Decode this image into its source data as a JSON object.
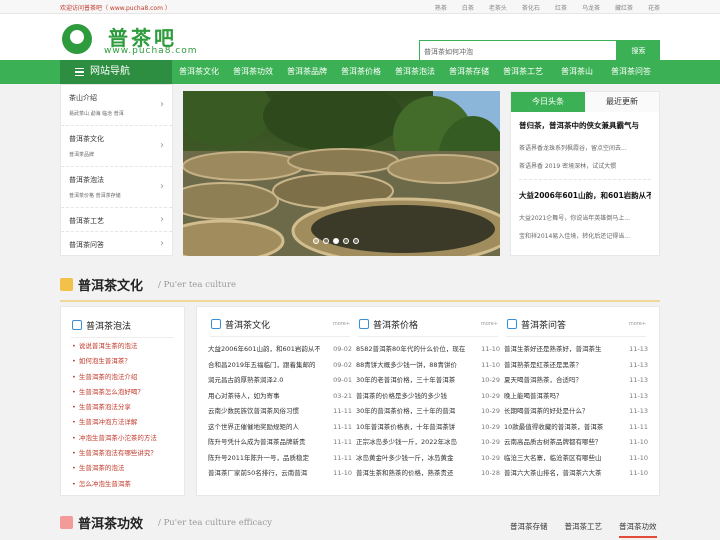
{
  "topbar": {
    "welcome": "欢迎访问普茶吧（ www.pucha8.com ）",
    "links": [
      "熟茶",
      "白茶",
      "老茶头",
      "茶化石",
      "红茶",
      "乌龙茶",
      "藏红茶",
      "花茶"
    ]
  },
  "logo": {
    "name": "普茶吧",
    "url": "www.pucha8.com"
  },
  "search": {
    "placeholder": "普洱茶如何冲泡",
    "button": "搜索"
  },
  "nav": {
    "title": "网站导航",
    "items": [
      "普洱茶文化",
      "普洱茶功效",
      "普洱茶品牌",
      "普洱茶价格",
      "普洱茶泡法",
      "普洱茶存储",
      "普洱茶工艺",
      "普洱茶山",
      "普洱茶问答"
    ]
  },
  "sidenav": [
    {
      "title": "茶山介绍",
      "sub": "易武茶山  勐海  临沧  普洱"
    },
    {
      "title": "普洱茶文化",
      "sub": "普洱茶品牌"
    },
    {
      "title": "普洱茶泡法",
      "sub": "普洱茶价格  普洱茶存储"
    },
    {
      "title": "普洱茶工艺",
      "sub": ""
    },
    {
      "title": "普洱茶问答",
      "sub": ""
    }
  ],
  "colors": {
    "brand_green": "#3cb054",
    "nav_dark_green": "#2d8d41",
    "accent_red": "#c0392b"
  },
  "news": {
    "tabs": [
      "今日头条",
      "最近更新"
    ],
    "blocks": [
      {
        "headline": "普归茶，普洱茶中的侠女兼具霸气与",
        "lines": [
          "茶语界香龙珠系列枫霞谷，留点空间去...",
          "茶语界香 2019 密境深林，试试大惯"
        ]
      },
      {
        "headline": "大益2006年601山韵，和601岩韵从不",
        "lines": [
          "大益2021仑舞号，你说当年英雄倒马上...",
          "宝和祥2014易入佳境，转化后还记得当..."
        ]
      }
    ]
  },
  "section1": {
    "title": "普洱茶文化",
    "subtitle": "/ Pu'er tea culture"
  },
  "brew": {
    "title": "普洱茶泡法",
    "items": [
      "说说普洱生茶的泡法",
      "如何泡生普洱茶？",
      "生普洱茶的泡法介绍",
      "生普洱茶怎么泡好喝？",
      "生普洱茶泡法分享",
      "生普洱冲泡方法详解",
      "冲泡生普洱茶小沱茶的方法",
      "生普洱茶泡法有哪些讲究？",
      "生普洱茶的泡法",
      "怎么冲泡生普洱茶"
    ]
  },
  "lists": [
    {
      "title": "普洱茶文化",
      "more": "more+",
      "rows": [
        {
          "t": "大益2006年601山韵，和601岩韵从不",
          "d": "09-02"
        },
        {
          "t": "合和昌2019年五福临门，跟着集邮的",
          "d": "09-02"
        },
        {
          "t": "润元昌古韵厚熟茶润泽2.0",
          "d": "09-01"
        },
        {
          "t": "用心对茶待人，如为寄事",
          "d": "03-21"
        },
        {
          "t": "云南少数民族饮普洱茶风俗习惯",
          "d": "11-11"
        },
        {
          "t": "这个世界正催催地奖励规矩的人",
          "d": "11-11"
        },
        {
          "t": "陈升号凭什么成为普洱茶品牌新贵",
          "d": "11-11"
        },
        {
          "t": "陈升号2011年陈升一号，品质稳定",
          "d": "11-11"
        },
        {
          "t": "普洱茶厂家前50名排行，云南普洱",
          "d": "11-10"
        }
      ]
    },
    {
      "title": "普洱茶价格",
      "more": "more+",
      "rows": [
        {
          "t": "8582普洱茶80年代的什么价位，现在",
          "d": "11-10"
        },
        {
          "t": "88青饼大概多少钱一饼，88青饼价",
          "d": "11-10"
        },
        {
          "t": "30年的老普洱价格，三十年普洱茶",
          "d": "10-29"
        },
        {
          "t": "普洱茶的价格是多少钱的多少钱",
          "d": "10-29"
        },
        {
          "t": "30年的普洱茶价格，三十年的普洱",
          "d": "10-29"
        },
        {
          "t": "10年普洱茶价格表，十年普洱茶饼",
          "d": "10-29"
        },
        {
          "t": "正宗冰岛多少钱一斤，2022年冰岛",
          "d": "10-29"
        },
        {
          "t": "冰岛黄金叶多少钱一斤，冰岛黄金",
          "d": "10-29"
        },
        {
          "t": "普洱生茶和熟茶的价格，熟茶贵还",
          "d": "10-28"
        }
      ]
    },
    {
      "title": "普洱茶问答",
      "more": "more+",
      "rows": [
        {
          "t": "普洱生茶好还是熟茶好，普洱茶生",
          "d": "11-13"
        },
        {
          "t": "普洱熟茶是红茶还是黑茶？",
          "d": "11-13"
        },
        {
          "t": "夏天喝普洱熟茶，合适吗？",
          "d": "11-13"
        },
        {
          "t": "晚上能喝普洱茶吗？",
          "d": "11-13"
        },
        {
          "t": "长期喝普洱茶的好处是什么？",
          "d": "11-13"
        },
        {
          "t": "10款最值得收藏的普洱茶，普洱茶",
          "d": "11-11"
        },
        {
          "t": "云南高品质古树茶品牌都有哪些？",
          "d": "11-10"
        },
        {
          "t": "临沧三大名寨，临沧茶区有哪些山",
          "d": "11-10"
        },
        {
          "t": "普洱六大茶山排名，普洱茶六大茶",
          "d": "11-10"
        }
      ]
    }
  ],
  "section2": {
    "title": "普洱茶功效",
    "subtitle": "/ Pu'er tea culture efficacy",
    "tabs": [
      "普洱茶存储",
      "普洱茶工艺",
      "普洱茶功效"
    ]
  }
}
